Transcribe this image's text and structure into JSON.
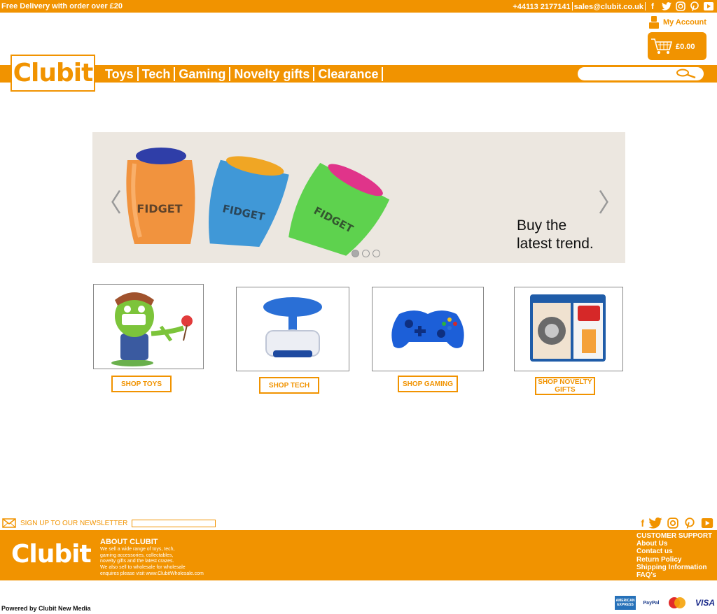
{
  "topbar": {
    "promo": "Free Delivery with order over  £20",
    "phone": "+44113 2177141",
    "email": "sales@clubit.co.uk"
  },
  "account": {
    "label": "My Account"
  },
  "cart": {
    "total": "£0.00"
  },
  "logo": {
    "text": "Clubit"
  },
  "nav": {
    "items": [
      "Toys",
      "Tech",
      "Gaming",
      "Novelty gifts",
      "Clearance"
    ]
  },
  "search": {
    "placeholder": ""
  },
  "hero": {
    "caption_line1": "Buy the",
    "caption_line2": "latest trend.",
    "prev": "〈",
    "next": "〉",
    "active_slide": 1,
    "slide_count": 3
  },
  "products": [
    {
      "name": "toys",
      "button": "SHOP TOYS"
    },
    {
      "name": "tech",
      "button": "SHOP TECH"
    },
    {
      "name": "gaming",
      "button": "SHOP GAMING"
    },
    {
      "name": "novelty",
      "button": "SHOP NOVELTY GIFTS"
    }
  ],
  "newsletter": {
    "label": "SIGN UP TO OUR NEWSLETTER"
  },
  "footer": {
    "logo": "Clubit",
    "about_title": "ABOUT CLUBIT",
    "about_lines": [
      "We sell a wide range of toys, tech,",
      "gaming accessories, collectables,",
      "novelty gifts and the latest crazes.",
      "We also sell to wholesale for wholesale",
      "enquires please visit www.ClubitWholesale.com"
    ],
    "support_title": "CUSTOMER SUPPORT",
    "support_links": [
      "About Us",
      "Contact us",
      "Return Policy",
      "Shipping Information",
      "FAQ's"
    ]
  },
  "powered": "Powered by Clubit New Media",
  "payments": [
    "AMERICAN EXPRESS",
    "PayPal",
    "MasterCard",
    "VISA"
  ],
  "colors": {
    "brand": "#f19300",
    "hero_bg": "#ece7e0"
  }
}
